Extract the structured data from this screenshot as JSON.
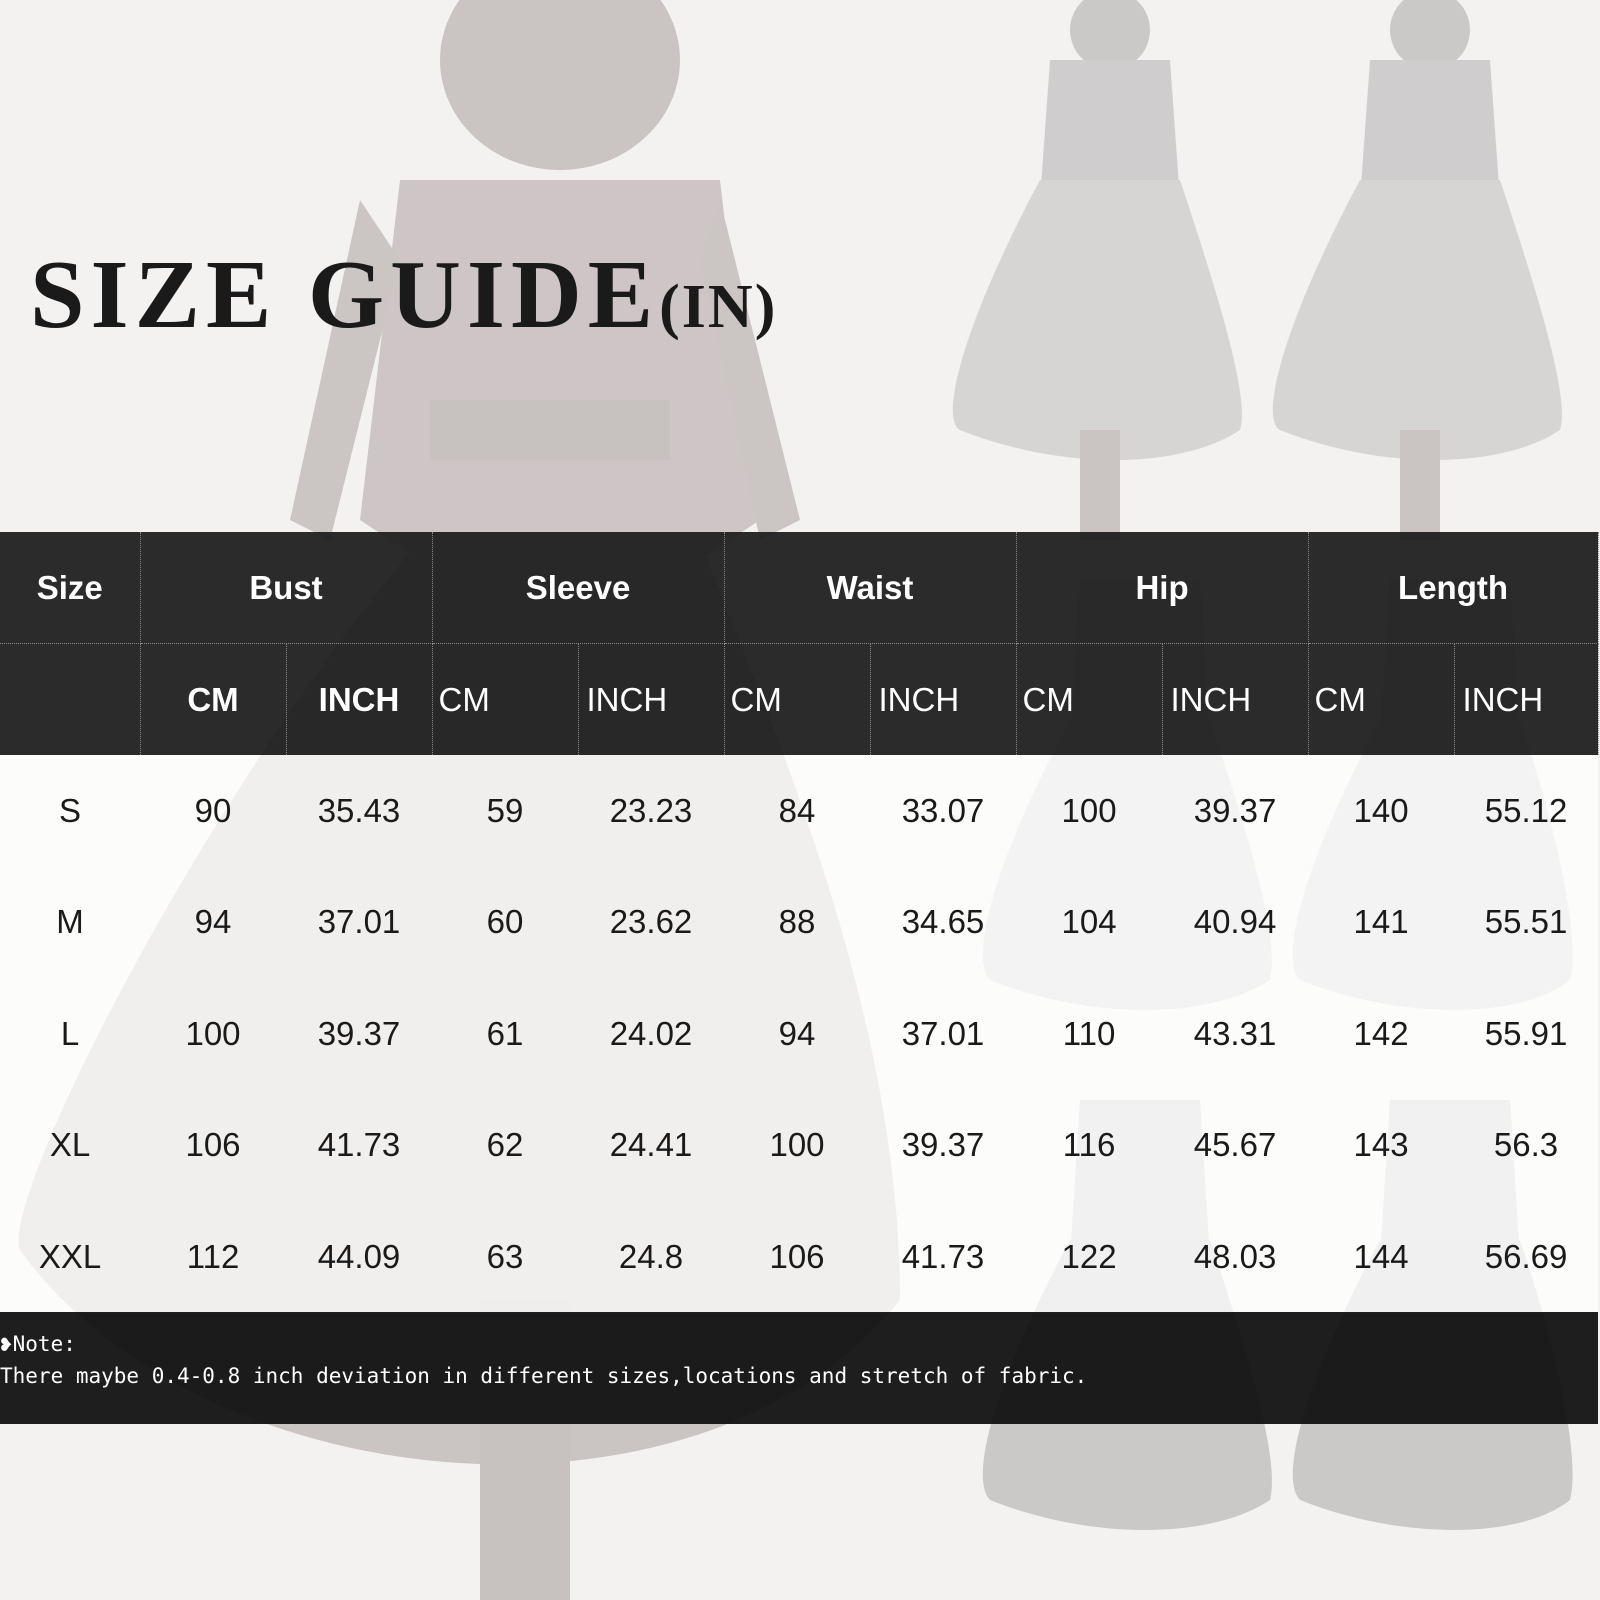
{
  "title": {
    "main": "SIZE GUIDE",
    "unit": "(IN)"
  },
  "table": {
    "group_headers": [
      "Size",
      "Bust",
      "Sleeve",
      "Waist",
      "Hip",
      "Length"
    ],
    "sub_headers": [
      "CM",
      "INCH",
      "CM",
      "INCH",
      "CM",
      "INCH",
      "CM",
      "INCH",
      "CM",
      "INCH"
    ],
    "rows": [
      [
        "S",
        "90",
        "35.43",
        "59",
        "23.23",
        "84",
        "33.07",
        "100",
        "39.37",
        "140",
        "55.12"
      ],
      [
        "M",
        "94",
        "37.01",
        "60",
        "23.62",
        "88",
        "34.65",
        "104",
        "40.94",
        "141",
        "55.51"
      ],
      [
        "L",
        "100",
        "39.37",
        "61",
        "24.02",
        "94",
        "37.01",
        "110",
        "43.31",
        "142",
        "55.91"
      ],
      [
        "XL",
        "106",
        "41.73",
        "62",
        "24.41",
        "100",
        "39.37",
        "116",
        "45.67",
        "143",
        "56.3"
      ],
      [
        "XXL",
        "112",
        "44.09",
        "63",
        "24.8",
        "106",
        "41.73",
        "122",
        "48.03",
        "144",
        "56.69"
      ]
    ]
  },
  "note": {
    "label": "❥Note:",
    "text": "There maybe 0.4-0.8 inch deviation in different sizes,locations and stretch of fabric."
  },
  "colors": {
    "header_bg": "#1c1c1c",
    "header_text": "#ffffff",
    "body_text": "#1a1a1a"
  }
}
